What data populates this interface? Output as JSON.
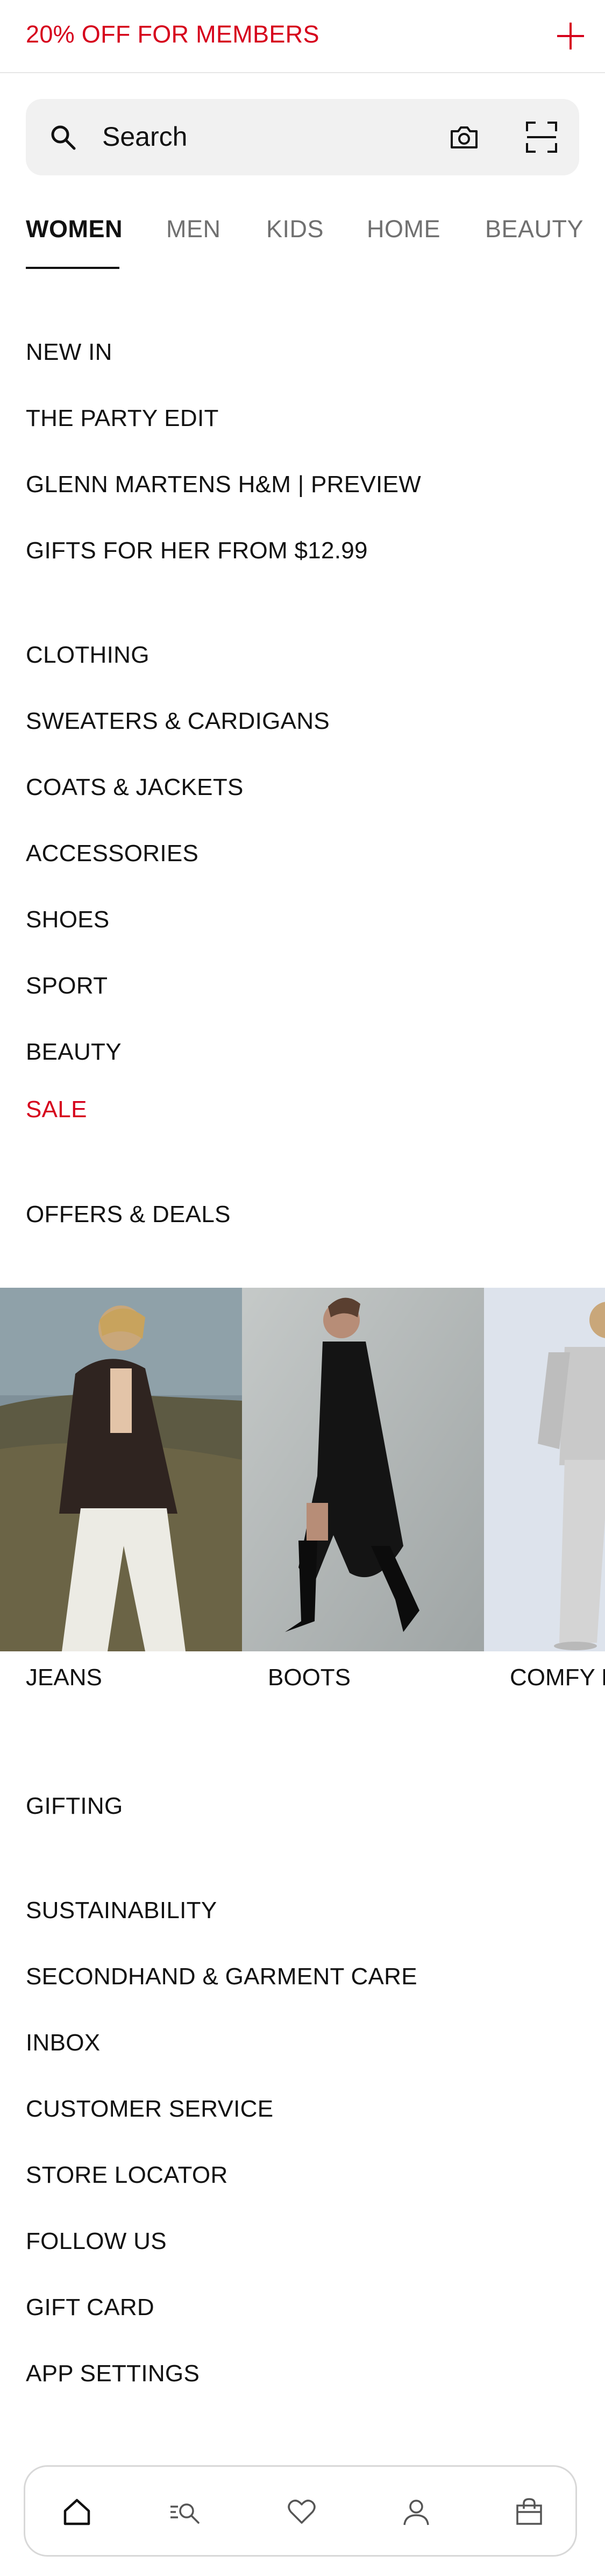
{
  "promo": {
    "text": "20% OFF FOR MEMBERS",
    "accent": "#d6001c",
    "icon": "plus-icon"
  },
  "search": {
    "placeholder": "Search",
    "icons": [
      "search-icon",
      "camera-icon",
      "scan-icon"
    ]
  },
  "tabs": [
    {
      "label": "WOMEN",
      "active": true
    },
    {
      "label": "MEN"
    },
    {
      "label": "KIDS"
    },
    {
      "label": "HOME"
    },
    {
      "label": "BEAUTY"
    }
  ],
  "featured": [
    "NEW IN",
    "THE PARTY EDIT",
    "GLENN MARTENS H&M | PREVIEW",
    "GIFTS FOR HER FROM $12.99"
  ],
  "categories": [
    "CLOTHING",
    "SWEATERS & CARDIGANS",
    "COATS & JACKETS",
    "ACCESSORIES",
    "SHOES",
    "SPORT",
    "BEAUTY"
  ],
  "sale": "SALE",
  "offers": "OFFERS & DEALS",
  "carousel": [
    {
      "label": "JEANS"
    },
    {
      "label": "BOOTS"
    },
    {
      "label": "COMFY LOUNGEWEAR"
    }
  ],
  "gifting": "GIFTING",
  "info_links": [
    "SUSTAINABILITY",
    "SECONDHAND & GARMENT CARE",
    "INBOX",
    "CUSTOMER SERVICE",
    "STORE LOCATOR",
    "FOLLOW US",
    "GIFT CARD",
    "APP SETTINGS"
  ],
  "bottom_nav": [
    "home-icon",
    "browse-icon",
    "favorites-icon",
    "account-icon",
    "bag-icon"
  ]
}
